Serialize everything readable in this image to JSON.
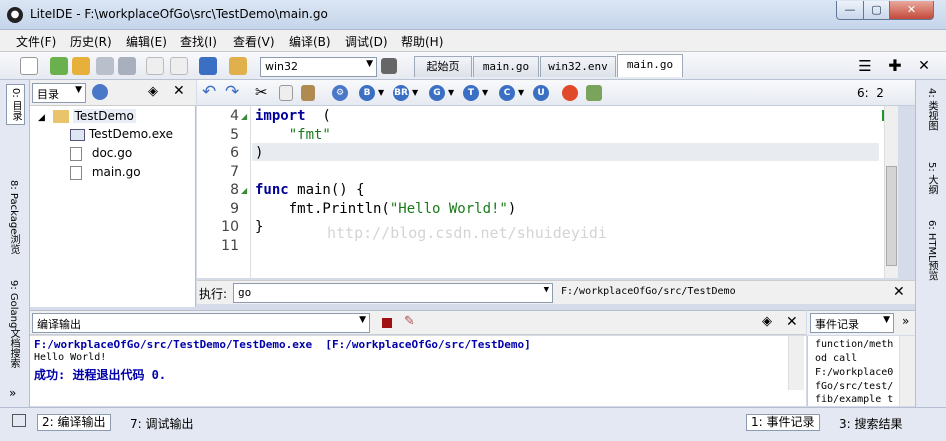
{
  "title": {
    "app": "LiteIDE",
    "text": "LiteIDE - F:\\workplaceOfGo\\src\\TestDemo\\main.go"
  },
  "window_buttons": {
    "minimize": "—",
    "maximize": "▢",
    "close": "✕"
  },
  "menu": [
    "文件(F)",
    "历史(R)",
    "编辑(E)",
    "查找(I)",
    "查看(V)",
    "编译(B)",
    "调试(D)",
    "帮助(H)"
  ],
  "toolbar": {
    "env_combo": "win32"
  },
  "tabs": [
    "起始页",
    "main.go",
    "win32.env",
    "main.go"
  ],
  "left_strip": {
    "tab1": "0: 目录",
    "tab2": "8: Package浏览",
    "tab3": "9: Golang文档搜索"
  },
  "file_panel": {
    "combo": "目录",
    "tree": [
      {
        "label": "TestDemo",
        "type": "folder"
      },
      {
        "label": "TestDemo.exe",
        "type": "exe"
      },
      {
        "label": "doc.go",
        "type": "file"
      },
      {
        "label": "main.go",
        "type": "file"
      }
    ]
  },
  "editor_toolbar": {
    "position": "6:  2",
    "buttons": [
      "B",
      "BR",
      "G",
      "T",
      "C",
      "U"
    ],
    "button_colors": [
      "#3a6fc4",
      "#3a6fc4",
      "#3a6fc4",
      "#3a6fc4",
      "#3a6fc4",
      "#3a6fc4"
    ]
  },
  "editor": {
    "lines": [
      {
        "n": "4",
        "code": "import  (",
        "fold": true
      },
      {
        "n": "5",
        "code": "    \"fmt\"",
        "fold": false
      },
      {
        "n": "6",
        "code": ")",
        "fold": false
      },
      {
        "n": "7",
        "code": "",
        "fold": false
      },
      {
        "n": "8",
        "code": "func main() {",
        "fold": true
      },
      {
        "n": "9",
        "code": "    fmt.Println(\"Hello World!\")",
        "fold": false
      },
      {
        "n": "10",
        "code": "}",
        "fold": false
      },
      {
        "n": "11",
        "code": "",
        "fold": false
      }
    ],
    "watermark": "http://blog.csdn.net/shuideyidi"
  },
  "right_strip": {
    "tab1": "4: 类视图",
    "tab2": "5: 大纲",
    "tab3": "6: HTML预览"
  },
  "exec_bar": {
    "label": "执行:",
    "value": "go",
    "path": "F:/workplaceOfGo/src/TestDemo"
  },
  "output": {
    "combo": "编译输出",
    "lines": [
      "F:/workplaceOfGo/src/TestDemo/TestDemo.exe  [F:/workplaceOfGo/src/TestDemo]",
      "Hello World!",
      "成功: 进程退出代码 0."
    ]
  },
  "events": {
    "combo": "事件记录",
    "lines": [
      "function/meth",
      "od call",
      "F:/workplace0",
      "fGo/src/test/",
      "fib/example t"
    ]
  },
  "status": {
    "tab1": "2: 编译输出",
    "tab2": "7: 调试输出",
    "tab3": "1: 事件记录",
    "tab4": "3: 搜索结果"
  }
}
